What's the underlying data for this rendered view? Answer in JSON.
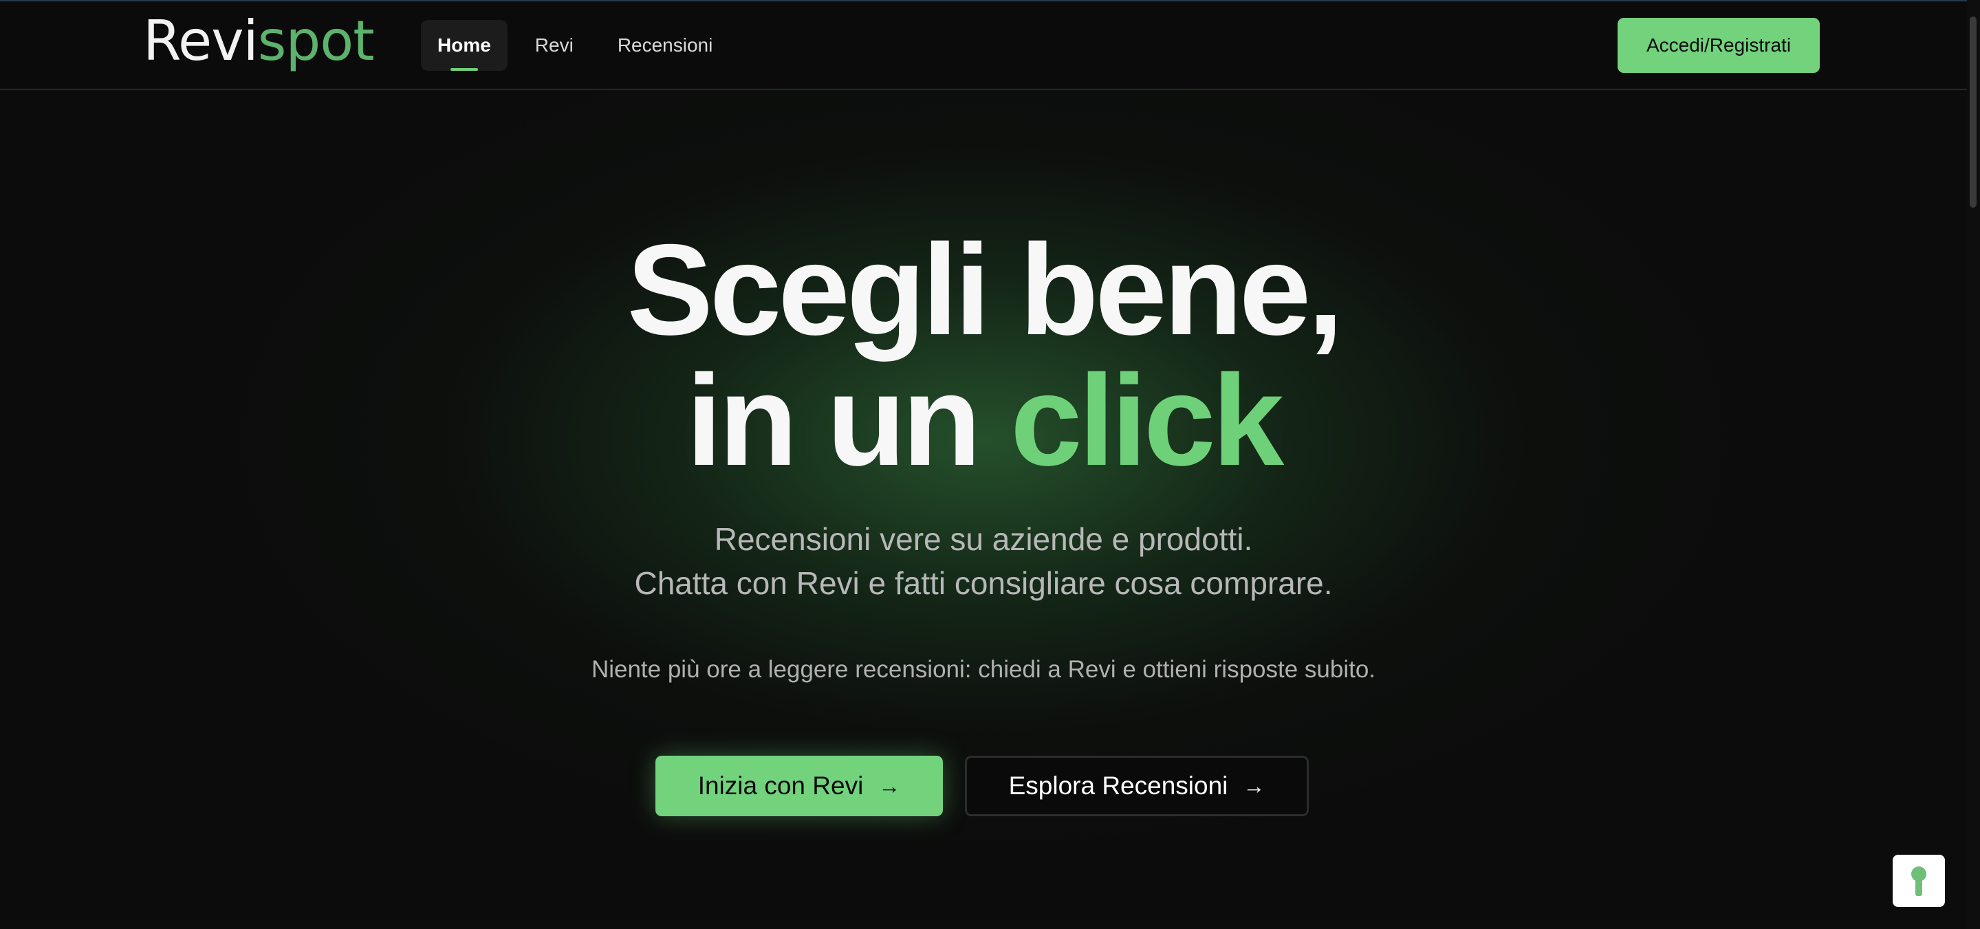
{
  "header": {
    "logo_part1": "Revi",
    "logo_part2": "spot",
    "nav": [
      {
        "label": "Home",
        "active": true
      },
      {
        "label": "Revi",
        "active": false
      },
      {
        "label": "Recensioni",
        "active": false
      }
    ],
    "login_label": "Accedi/Registrati"
  },
  "hero": {
    "title_line1": "Scegli bene,",
    "title_line2_prefix": "in un ",
    "title_line2_accent": "click",
    "subtitle_line1": "Recensioni vere su aziende e prodotti.",
    "subtitle_line2": "Chatta con Revi e fatti consigliare cosa comprare.",
    "tagline": "Niente più ore a leggere recensioni: chiedi a Revi e ottieni risposte subito.",
    "cta_primary": "Inizia con Revi",
    "cta_secondary": "Esplora Recensioni",
    "arrow": "→"
  },
  "colors": {
    "accent": "#72d37c",
    "background": "#0b0b0b",
    "logo_green": "#5cb36c"
  },
  "icons": {
    "cta_arrow": "arrow-right-icon",
    "cookie": "keyhole-icon"
  }
}
